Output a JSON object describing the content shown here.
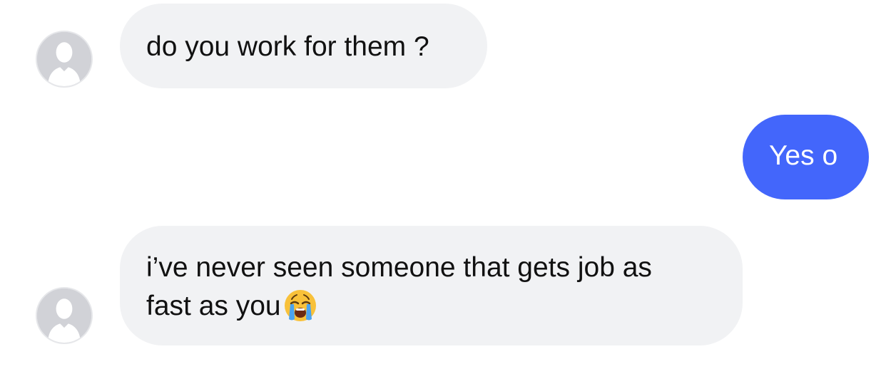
{
  "messages": [
    {
      "direction": "incoming",
      "text": "do you work for them ?",
      "avatar_icon": "default-avatar-icon"
    },
    {
      "direction": "outgoing",
      "text": "Yes o"
    },
    {
      "direction": "incoming",
      "line1": "i’ve never seen someone that gets job as",
      "line2": "fast as you",
      "emoji": "loudly-crying-face-emoji",
      "avatar_icon": "default-avatar-icon"
    }
  ],
  "colors": {
    "incoming_bubble": "#f1f2f4",
    "outgoing_bubble": "#4366fb",
    "avatar": "#d1d2d7"
  }
}
